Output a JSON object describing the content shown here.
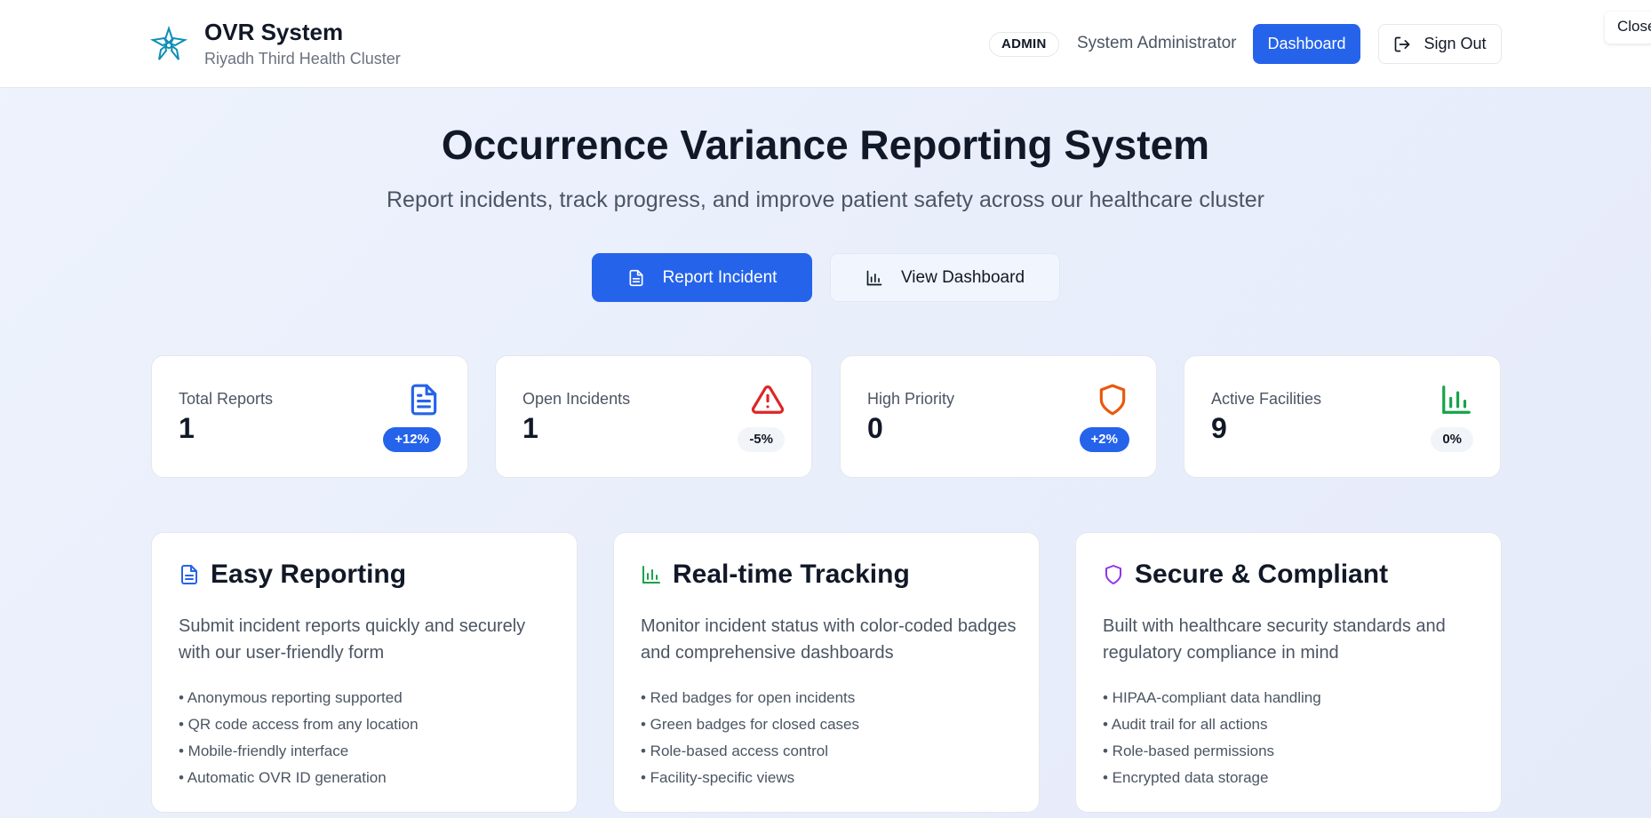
{
  "header": {
    "brand_title": "OVR System",
    "brand_subtitle": "Riyadh Third Health Cluster",
    "role_badge": "ADMIN",
    "user_name": "System Administrator",
    "dashboard_label": "Dashboard",
    "signout_label": "Sign Out",
    "close_label": "Close"
  },
  "hero": {
    "title": "Occurrence Variance Reporting System",
    "subtitle": "Report incidents, track progress, and improve patient safety across our healthcare cluster",
    "report_label": "Report Incident",
    "view_label": "View Dashboard"
  },
  "stats": [
    {
      "label": "Total Reports",
      "value": "1",
      "change": "+12%",
      "icon": "document-icon",
      "color": "#2563eb"
    },
    {
      "label": "Open Incidents",
      "value": "1",
      "change": "-5%",
      "icon": "alert-triangle-icon",
      "color": "#dc2626"
    },
    {
      "label": "High Priority",
      "value": "0",
      "change": "+2%",
      "icon": "shield-icon",
      "color": "#ea580c"
    },
    {
      "label": "Active Facilities",
      "value": "9",
      "change": "0%",
      "icon": "bar-chart-icon",
      "color": "#16a34a"
    }
  ],
  "features": [
    {
      "title": "Easy Reporting",
      "icon": "document-icon",
      "color": "#2563eb",
      "description": "Submit incident reports quickly and securely with our user-friendly form",
      "items": [
        "• Anonymous reporting supported",
        "• QR code access from any location",
        "• Mobile-friendly interface",
        "• Automatic OVR ID generation"
      ]
    },
    {
      "title": "Real-time Tracking",
      "icon": "bar-chart-icon",
      "color": "#16a34a",
      "description": "Monitor incident status with color-coded badges and comprehensive dashboards",
      "items": [
        "• Red badges for open incidents",
        "• Green badges for closed cases",
        "• Role-based access control",
        "• Facility-specific views"
      ]
    },
    {
      "title": "Secure & Compliant",
      "icon": "shield-icon",
      "color": "#9333ea",
      "description": "Built with healthcare security standards and regulatory compliance in mind",
      "items": [
        "• HIPAA-compliant data handling",
        "• Audit trail for all actions",
        "• Role-based permissions",
        "• Encrypted data storage"
      ]
    }
  ]
}
